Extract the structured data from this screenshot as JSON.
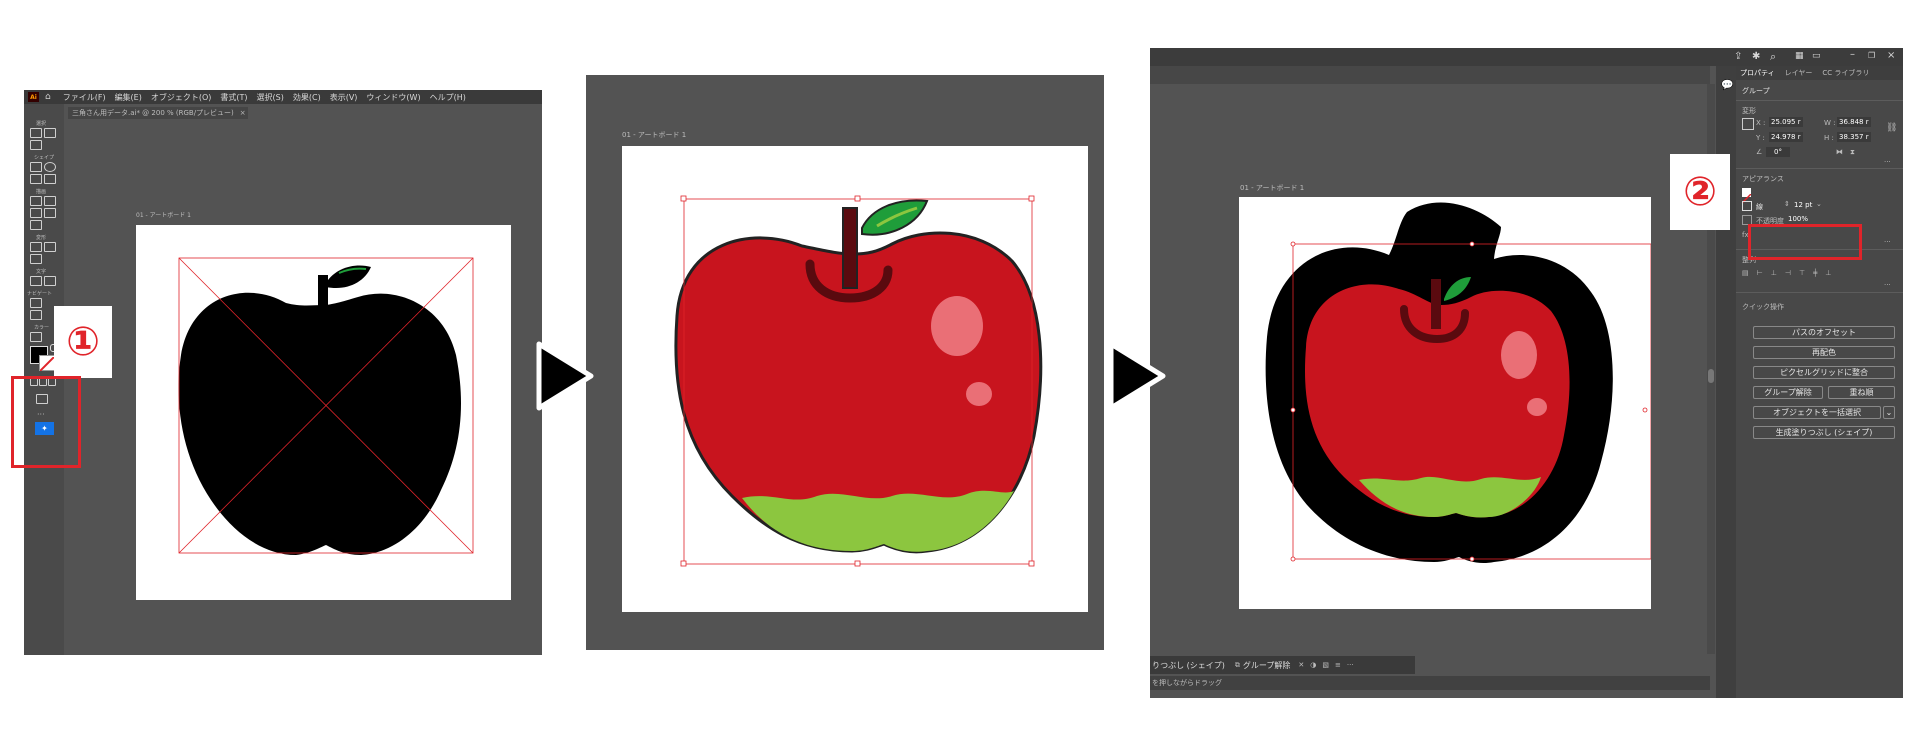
{
  "callouts": {
    "one": "①",
    "two": "②"
  },
  "panel1": {
    "app_icon": "Ai",
    "menu": [
      "ファイル(F)",
      "編集(E)",
      "オブジェクト(O)",
      "書式(T)",
      "選択(S)",
      "効果(C)",
      "表示(V)",
      "ウィンドウ(W)",
      "ヘルプ(H)"
    ],
    "doc_tab": "三角さん用データ.ai* @ 200 % (RGB/プレビュー)",
    "doc_tab_close": "×",
    "artboard_label": "01 - アートボード 1",
    "tool_groups": [
      "選択",
      "シェイプ",
      "描画",
      "変形",
      "文字",
      "ナビゲート",
      "カラー"
    ]
  },
  "panel2": {
    "artboard_label": "01 - アートボード 1"
  },
  "panel3": {
    "artboard_label": "01 - アートボード 1",
    "tabs": [
      "プロパティ",
      "レイヤー",
      "CC ライブラリ"
    ],
    "group_title": "グループ",
    "transform": {
      "title": "変形",
      "x_label": "X :",
      "x_value": "25.095 r",
      "y_label": "Y :",
      "y_value": "24.978 r",
      "w_label": "W :",
      "w_value": "36.848 r",
      "h_label": "H :",
      "h_value": "38.357 r",
      "angle": "0°"
    },
    "appearance": {
      "title": "アピアランス",
      "stroke_label": "線",
      "stroke_value": "12 pt",
      "opacity_label": "不透明度",
      "opacity_value": "100%",
      "fx": "fx."
    },
    "align_title": "整列",
    "quick_title": "クイック操作",
    "quick_buttons": [
      "パスのオフセット",
      "再配色",
      "ピクセルグリッドに整合"
    ],
    "ungroup": "グループ解除",
    "stack": "重ね順",
    "select_same": "オブジェクトを一括選択",
    "gen_fill": "生成塗りつぶし (シェイプ)",
    "context_bar": {
      "gen_fill": "りつぶし (シェイプ)",
      "ungroup": "グループ解除",
      "more": "···"
    },
    "status": "を押しながらドラッグ"
  },
  "colors": {
    "accent_red": "#e0242a",
    "app_bg": "#535353",
    "apple_red": "#c8141e",
    "apple_green": "#8cc63f",
    "leaf_green": "#1f9d3a"
  }
}
